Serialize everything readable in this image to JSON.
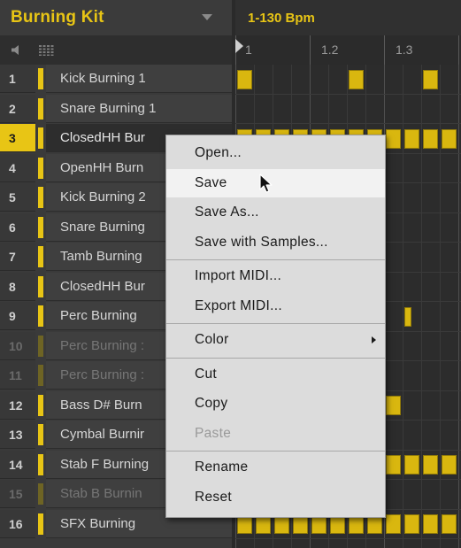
{
  "header": {
    "kit_name": "Burning Kit",
    "tempo_range": "1-130 Bpm"
  },
  "ruler": {
    "labels": [
      "1",
      "1.2",
      "1.3"
    ]
  },
  "sounds": [
    {
      "number": "1",
      "name": "Kick Burning 1",
      "state": "normal"
    },
    {
      "number": "2",
      "name": "Snare Burning 1",
      "state": "normal"
    },
    {
      "number": "3",
      "name": "ClosedHH Bur",
      "state": "selected"
    },
    {
      "number": "4",
      "name": "OpenHH Burn",
      "state": "normal"
    },
    {
      "number": "5",
      "name": "Kick Burning 2",
      "state": "normal"
    },
    {
      "number": "6",
      "name": "Snare Burning",
      "state": "normal"
    },
    {
      "number": "7",
      "name": "Tamb Burning",
      "state": "normal"
    },
    {
      "number": "8",
      "name": "ClosedHH Bur",
      "state": "normal"
    },
    {
      "number": "9",
      "name": "Perc Burning",
      "state": "normal"
    },
    {
      "number": "10",
      "name": "Perc Burning :",
      "state": "dim"
    },
    {
      "number": "11",
      "name": "Perc Burning :",
      "state": "dim"
    },
    {
      "number": "12",
      "name": "Bass D# Burn",
      "state": "normal"
    },
    {
      "number": "13",
      "name": "Cymbal Burnir",
      "state": "normal"
    },
    {
      "number": "14",
      "name": "Stab F Burning",
      "state": "normal"
    },
    {
      "number": "15",
      "name": "Stab B Burnin",
      "state": "dim"
    },
    {
      "number": "16",
      "name": "SFX Burning",
      "state": "normal"
    }
  ],
  "context_menu": {
    "items": [
      {
        "label": "Open...",
        "state": "normal"
      },
      {
        "label": "Save",
        "state": "hover"
      },
      {
        "label": "Save As...",
        "state": "normal"
      },
      {
        "label": "Save with Samples...",
        "state": "normal"
      },
      {
        "label": "Import MIDI...",
        "state": "normal"
      },
      {
        "label": "Export MIDI...",
        "state": "normal"
      },
      {
        "label": "Color",
        "state": "submenu"
      },
      {
        "label": "Cut",
        "state": "normal"
      },
      {
        "label": "Copy",
        "state": "normal"
      },
      {
        "label": "Paste",
        "state": "disabled"
      },
      {
        "label": "Rename",
        "state": "normal"
      },
      {
        "label": "Reset",
        "state": "normal"
      }
    ]
  },
  "colors": {
    "accent": "#e8c515",
    "note": "#d9b70f",
    "menu_bg": "#dcdcdc"
  },
  "icons": [
    "speaker-icon",
    "grid-icon",
    "dropdown-arrow-icon",
    "playhead-icon",
    "submenu-arrow-icon",
    "mouse-cursor-icon"
  ]
}
